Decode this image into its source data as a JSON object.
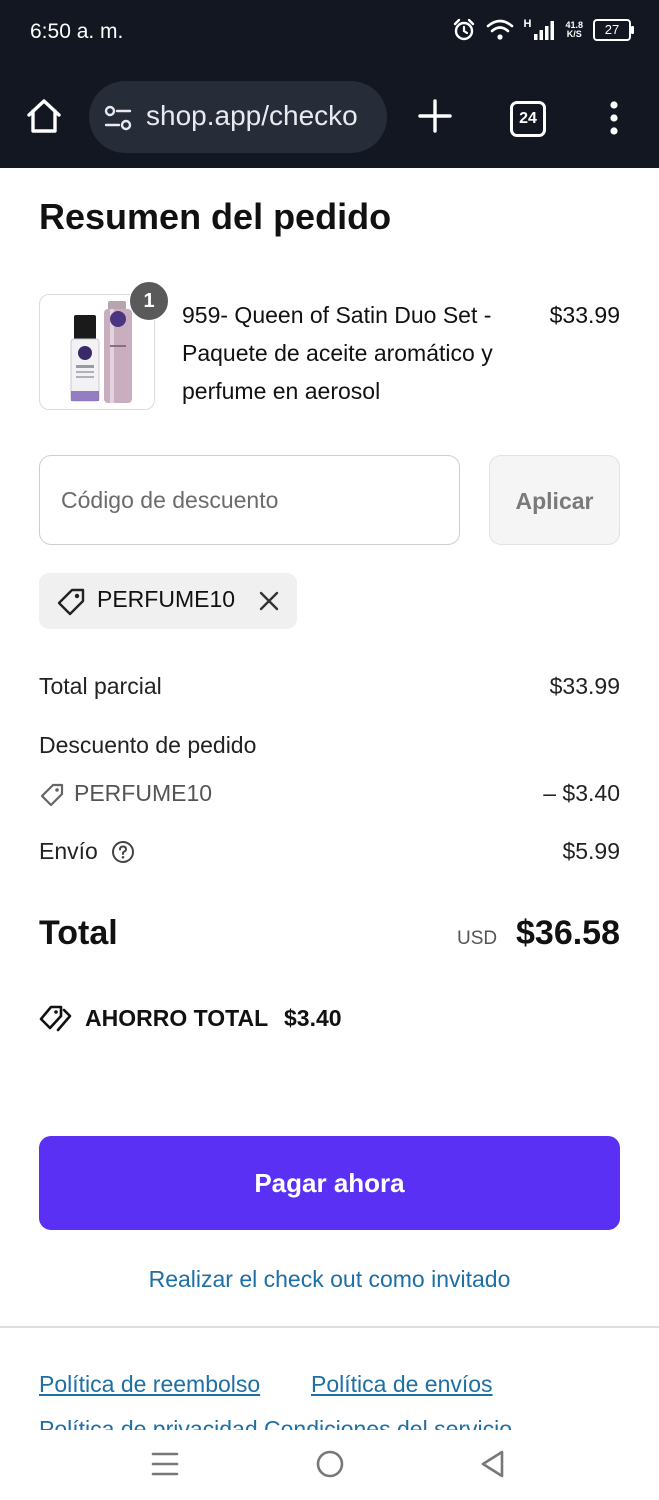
{
  "status_bar": {
    "time": "6:50 a. m.",
    "network_speed": "41.8",
    "network_unit": "K/S",
    "network_type": "H",
    "battery": "27"
  },
  "browser": {
    "url": "shop.app/checko",
    "tab_count": "24"
  },
  "order": {
    "title": "Resumen del pedido",
    "item": {
      "quantity": "1",
      "name": "959- Queen of Satin Duo Set - Paquete de aceite aromático y perfume en aerosol",
      "price": "$33.99"
    },
    "discount": {
      "placeholder": "Código de descuento",
      "apply_label": "Aplicar",
      "applied_code": "PERFUME10"
    },
    "summary": {
      "subtotal_label": "Total parcial",
      "subtotal_value": "$33.99",
      "order_discount_label": "Descuento de pedido",
      "order_discount_code": "PERFUME10",
      "order_discount_value": "– $3.40",
      "shipping_label": "Envío",
      "shipping_value": "$5.99",
      "total_label": "Total",
      "total_currency": "USD",
      "total_value": "$36.58",
      "savings_label": "AHORRO TOTAL",
      "savings_value": "$3.40"
    },
    "pay_label": "Pagar ahora",
    "guest_label": "Realizar el check out como invitado"
  },
  "footer": {
    "refund_policy": "Política de reembolso",
    "shipping_policy": "Política de envíos",
    "cutoff_text": "Política de privacidad   Condiciones del servicio"
  },
  "colors": {
    "accent": "#5a31f4",
    "link": "#1d6fa5",
    "topbar": "#121722"
  }
}
